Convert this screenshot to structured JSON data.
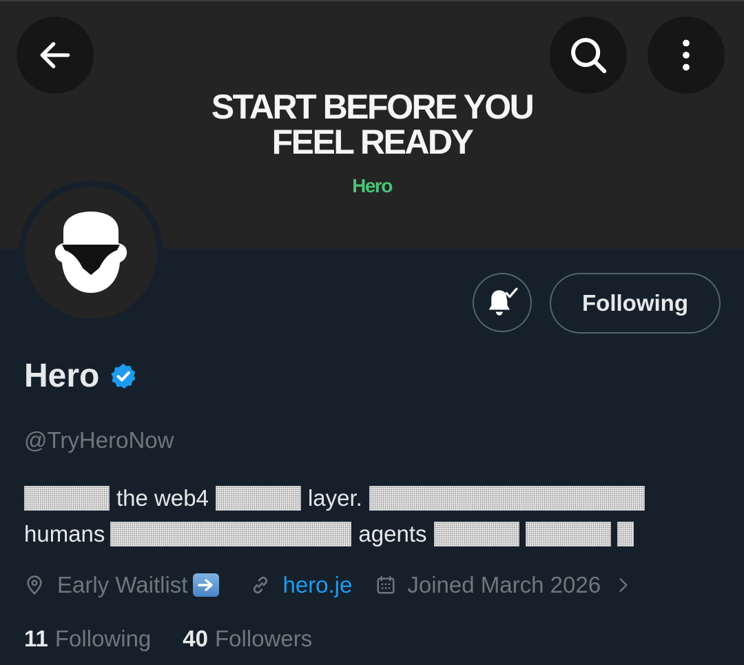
{
  "banner": {
    "headline_line1": "START BEFORE YOU",
    "headline_line2": "FEEL READY",
    "brand": "Hero"
  },
  "header": {
    "back_icon": "arrow-left-icon",
    "search_icon": "search-icon",
    "more_icon": "more-vertical-icon"
  },
  "actions": {
    "notifications_icon": "bell-check-icon",
    "following_label": "Following"
  },
  "profile": {
    "name": "Hero",
    "verified": true,
    "handle": "@TryHeroNow",
    "bio": {
      "line1_part1": "the web4",
      "line1_part2": "layer.",
      "line2_part1": "humans",
      "line2_part2": "agents"
    },
    "location": "Early Waitlist",
    "location_emoji": "➡️",
    "website": "hero.je",
    "joined": "Joined March 2026"
  },
  "stats": {
    "following_count": "11",
    "following_label": "Following",
    "followers_count": "40",
    "followers_label": "Followers"
  },
  "colors": {
    "background": "#15202b",
    "banner": "#242424",
    "brand_green": "#4bc275",
    "link_blue": "#1d9bf0",
    "muted": "#71767b",
    "verified_blue": "#1d9bf0"
  }
}
